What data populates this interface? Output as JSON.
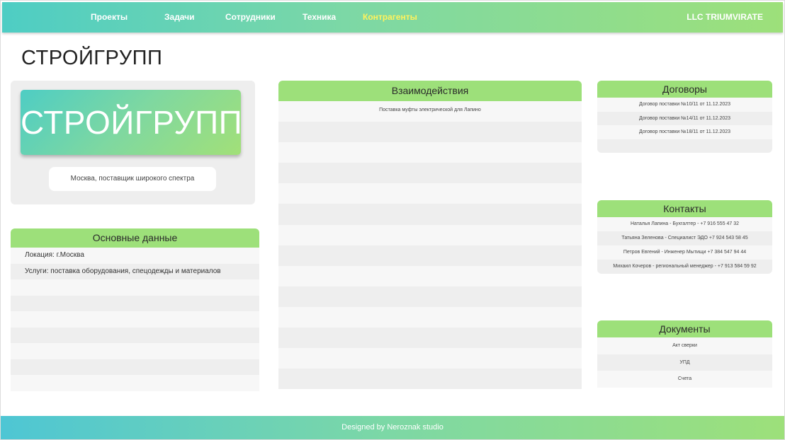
{
  "nav": {
    "items": [
      {
        "label": "Проекты"
      },
      {
        "label": "Задачи"
      },
      {
        "label": "Сотрудники"
      },
      {
        "label": "Техника"
      },
      {
        "label": "Контрагенты"
      }
    ],
    "active": "Контрагенты",
    "brand": "LLC TRIUMVIRATE"
  },
  "page": {
    "title": "СТРОЙГРУПП"
  },
  "company": {
    "logo_text": "СТРОЙГРУПП",
    "description": "Москва, поставщик широкого спектра"
  },
  "main_data": {
    "title": "Основные данные",
    "rows": [
      "Локация: г.Москва",
      "Услуги: поставка оборудования, спецодежды и материалов",
      "",
      "",
      "",
      "",
      "",
      "",
      ""
    ]
  },
  "interactions": {
    "title": "Взаимодействия",
    "rows": [
      "Поставка муфты электрической для Лапино",
      "",
      "",
      "",
      "",
      "",
      "",
      "",
      "",
      "",
      "",
      "",
      "",
      ""
    ]
  },
  "contracts": {
    "title": "Договоры",
    "rows": [
      "Договор поставки №10/11 от 11.12.2023",
      "Договор поставки №14/11 от 11.12.2023",
      "Договор поставки №18/11 от 11.12.2023",
      ""
    ]
  },
  "contacts": {
    "title": "Контакты",
    "rows": [
      "Наталья Лапина - Бухгалтер - +7 916 555 47 32",
      "Татьяна Зеленова - Специалист ЭДО +7 924 543 58 45",
      "Петров Евгений - Инженер Мытищи +7 384 547 94 44",
      "Михаил Кочеров - региональный менеджер - +7 913 584 59 92"
    ]
  },
  "documents": {
    "title": "Документы",
    "rows": [
      "Акт сверки",
      "УПД",
      "Счета"
    ]
  },
  "footer": {
    "text": "Designed by Neroznak studio"
  },
  "colors": {
    "accent_green": "#9de07a",
    "accent_teal": "#4ecdc4",
    "active_nav": "#fff25c"
  }
}
